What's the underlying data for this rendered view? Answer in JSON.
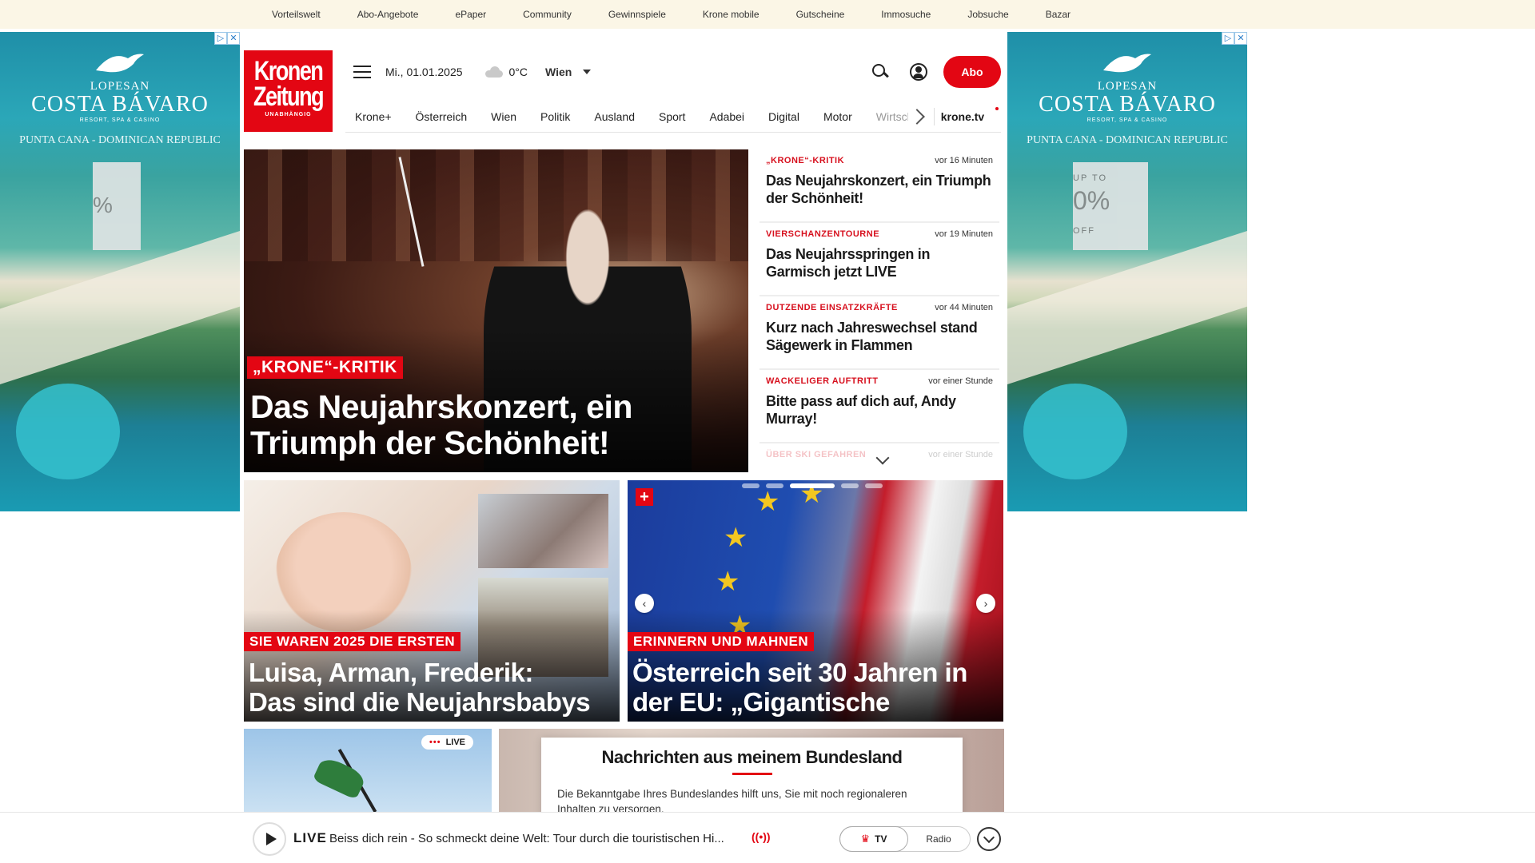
{
  "topbar": {
    "links": [
      "Vorteilswelt",
      "Abo-Angebote",
      "ePaper",
      "Community",
      "Gewinnspiele",
      "Krone mobile",
      "Gutscheine",
      "Immosuche",
      "Jobsuche",
      "Bazar"
    ]
  },
  "ads": {
    "brand_top": "LOPESAN",
    "brand_main": "COSTA BÁVARO",
    "brand_sub": "RESORT, SPA & CASINO",
    "location": "PUNTA CANA - DOMINICAN REPUBLIC",
    "promo_left": "%",
    "promo_right_top": "UP TO",
    "promo_right_big": "0%",
    "promo_right_bottom": "OFF"
  },
  "logo": {
    "line1": "Kronen",
    "line2": "Zeitung",
    "line3": "UNABHÄNGIG",
    "color": "#e30613"
  },
  "header": {
    "date": "Mi., 01.01.2025",
    "temperature": "0°C",
    "city": "Wien",
    "abo_label": "Abo"
  },
  "nav": {
    "items": [
      "Krone+",
      "Österreich",
      "Wien",
      "Politik",
      "Ausland",
      "Sport",
      "Adabei",
      "Digital",
      "Motor"
    ],
    "faded_item": "Wirtschaft",
    "tv": "krone.tv"
  },
  "hero": {
    "kicker": "„KRONE“-KRITIK",
    "title": "Das Neujahrskonzert, ein Triumph der Schönheit!"
  },
  "sidebar": {
    "items": [
      {
        "kicker": "„KRONE“-KRITIK",
        "time": "vor 16 Minuten",
        "title": "Das Neujahrskonzert, ein Triumph der Schönheit!"
      },
      {
        "kicker": "VIERSCHANZENTOURNE",
        "time": "vor 19 Minuten",
        "title": "Das Neujahrsspringen in Garmisch jetzt LIVE"
      },
      {
        "kicker": "DUTZENDE EINSATZKRÄFTE",
        "time": "vor 44 Minuten",
        "title": "Kurz nach Jahreswechsel stand Sägewerk in Flammen"
      },
      {
        "kicker": "WACKELIGER AUFTRITT",
        "time": "vor einer Stunde",
        "title": "Bitte pass auf dich auf, Andy Murray!"
      },
      {
        "kicker": "ÜBER SKI GEFAHREN",
        "time": "vor einer Stunde",
        "title": ""
      }
    ]
  },
  "cards": [
    {
      "kicker": "SIE WAREN 2025 DIE ERSTEN",
      "line1": "Luisa, Arman, Frederik:",
      "line2": "Das sind die Neujahrsbabys"
    },
    {
      "kicker": "ERINNERN UND MAHNEN",
      "line1": "Österreich seit 30 Jahren in",
      "line2": "der EU: „Gigantische Leistung“"
    }
  ],
  "live_badge": "LIVE",
  "region": {
    "title": "Nachrichten aus meinem Bundesland",
    "text": "Die Bekanntgabe Ihres Bundeslandes hilft uns, Sie mit noch regionaleren Inhalten zu versorgen."
  },
  "player": {
    "live": "LIVE",
    "stream": "Beiss dich rein - So schmeckt deine Welt: Tour durch die touristischen Hi...",
    "broadcast_icon": "((•))",
    "tv": "TV",
    "radio": "Radio"
  }
}
